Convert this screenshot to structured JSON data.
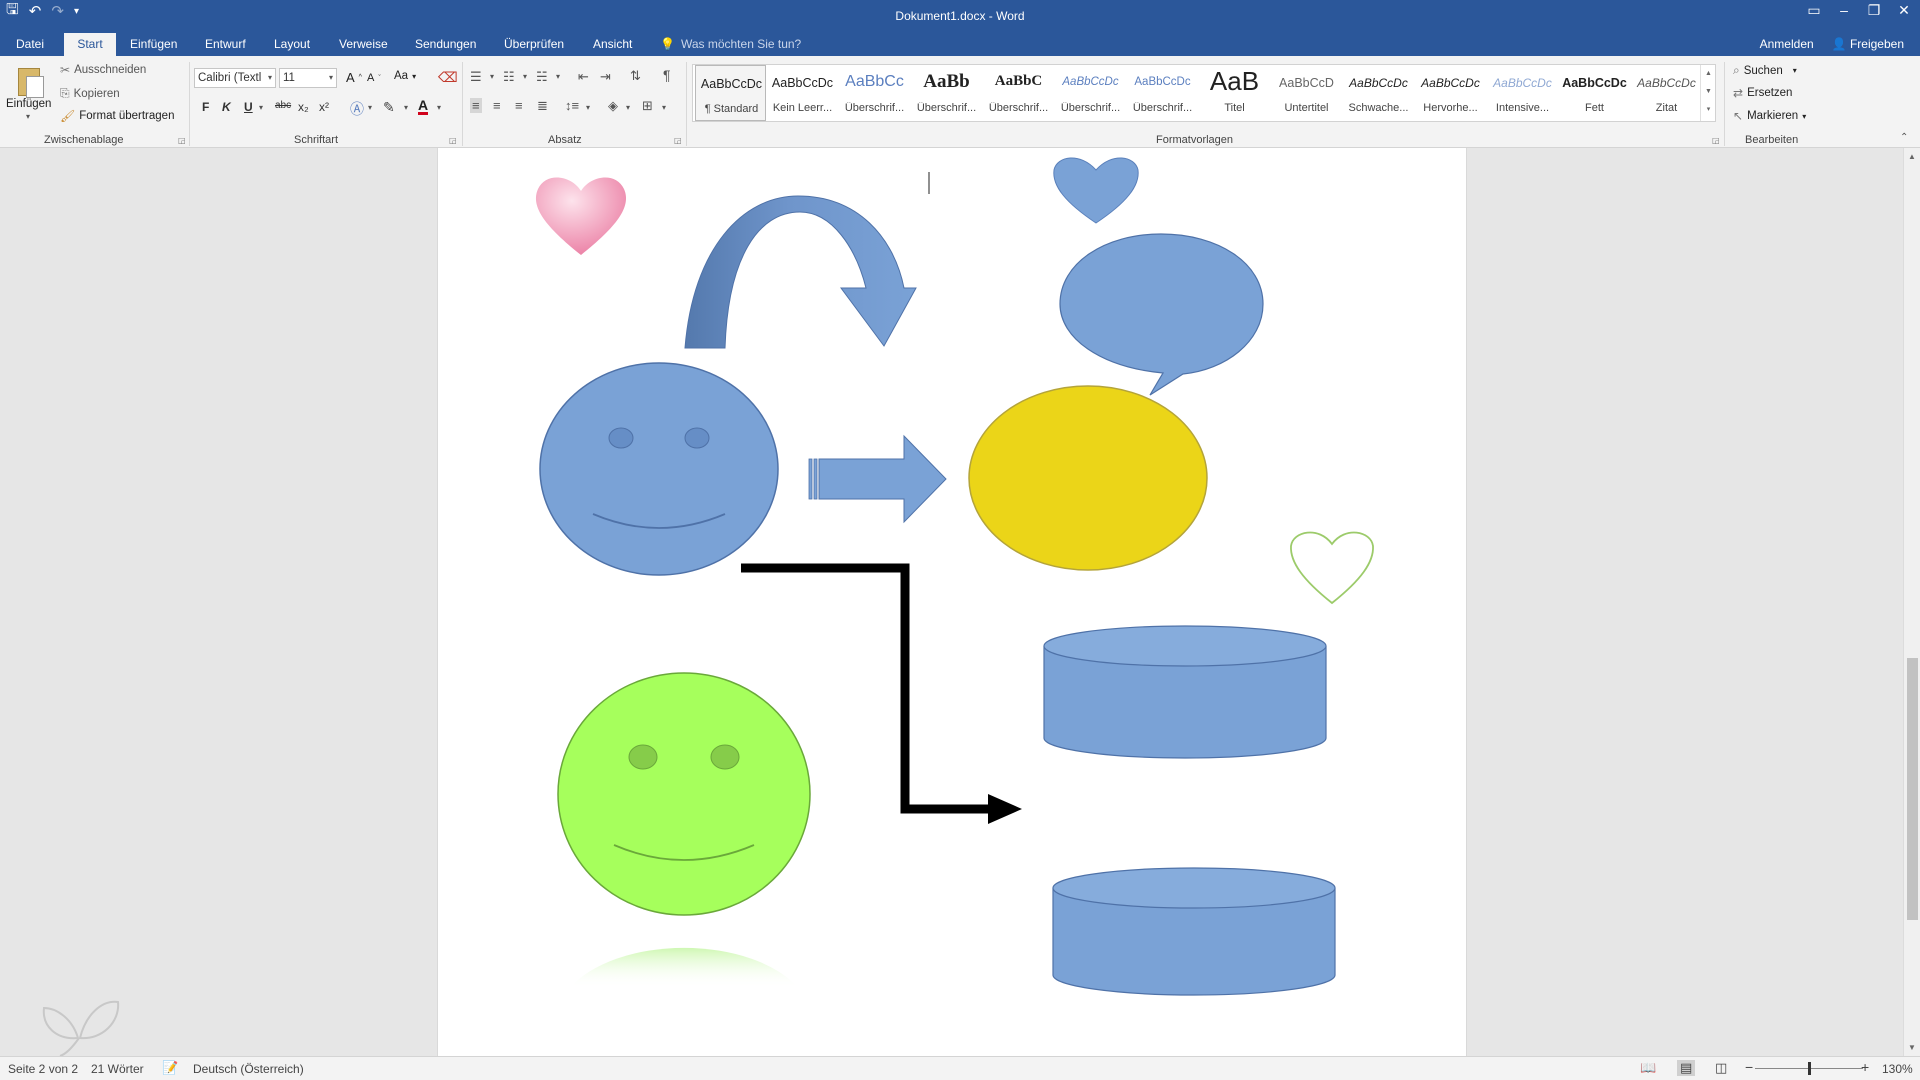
{
  "window": {
    "title": "Dokument1.docx - Word"
  },
  "tabs": {
    "items": [
      "Datei",
      "Start",
      "Einfügen",
      "Entwurf",
      "Layout",
      "Verweise",
      "Sendungen",
      "Überprüfen",
      "Ansicht"
    ],
    "active": "Start",
    "tell_me": "Was möchten Sie tun?",
    "sign_in": "Anmelden",
    "share": "Freigeben"
  },
  "ribbon": {
    "clipboard": {
      "label": "Zwischenablage",
      "paste": "Einfügen",
      "cut": "Ausschneiden",
      "copy": "Kopieren",
      "format_painter": "Format übertragen"
    },
    "font": {
      "label": "Schriftart",
      "font_name": "Calibri (Textl",
      "font_size": "11",
      "bold": "F",
      "italic": "K",
      "underline": "U",
      "strike": "abc",
      "sub": "x₂",
      "sup": "x²",
      "case": "Aa",
      "grow": "A",
      "shrink": "A"
    },
    "paragraph": {
      "label": "Absatz"
    },
    "styles": {
      "label": "Formatvorlagen",
      "items": [
        {
          "preview": "AaBbCcDc",
          "name": "¶ Standard"
        },
        {
          "preview": "AaBbCcDc",
          "name": "Kein Leerr..."
        },
        {
          "preview": "AaBbCc",
          "name": "Überschrif..."
        },
        {
          "preview": "AaBb",
          "name": "Überschrif..."
        },
        {
          "preview": "AaBbC",
          "name": "Überschrif..."
        },
        {
          "preview": "AaBbCcDc",
          "name": "Überschrif..."
        },
        {
          "preview": "AaBbCcDc",
          "name": "Überschrif..."
        },
        {
          "preview": "AaB",
          "name": "Titel"
        },
        {
          "preview": "AaBbCcD",
          "name": "Untertitel"
        },
        {
          "preview": "AaBbCcDc",
          "name": "Schwache..."
        },
        {
          "preview": "AaBbCcDc",
          "name": "Hervorhe..."
        },
        {
          "preview": "AaBbCcDc",
          "name": "Intensive..."
        },
        {
          "preview": "AaBbCcDc",
          "name": "Fett"
        },
        {
          "preview": "AaBbCcDc",
          "name": "Zitat"
        }
      ]
    },
    "editing": {
      "label": "Bearbeiten",
      "find": "Suchen",
      "replace": "Ersetzen",
      "select": "Markieren"
    }
  },
  "status": {
    "page": "Seite 2 von 2",
    "words": "21 Wörter",
    "language": "Deutsch (Österreich)",
    "zoom": "130%"
  },
  "colors": {
    "accent": "#2b579a",
    "shape_blue": "#7aa2d6",
    "shape_yellow": "#ebd518",
    "shape_green": "#a6ff5c",
    "heart_pink": "#f3a6c0"
  }
}
